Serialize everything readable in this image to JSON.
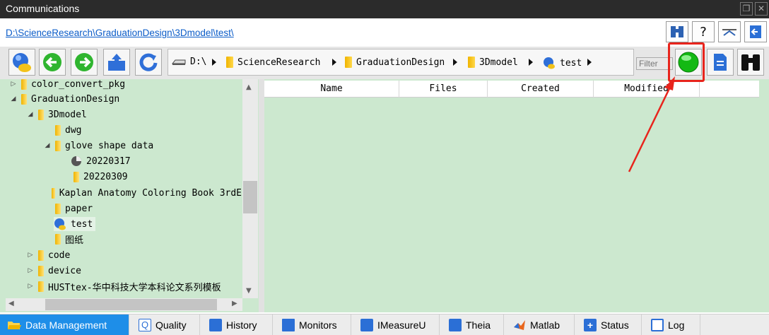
{
  "window": {
    "title": "Communications"
  },
  "path": {
    "text": "D:\\ScienceResearch\\GraduationDesign\\3Dmodel\\test\\"
  },
  "breadcrumb": {
    "drive": "D:\\",
    "items": [
      "ScienceResearch",
      "GraduationDesign",
      "3Dmodel",
      "test"
    ]
  },
  "toolbar": {
    "filter_placeholder": "Filter",
    "help_label": "?"
  },
  "tree": {
    "items": [
      {
        "label": "color_convert_pkg"
      },
      {
        "label": "GraduationDesign"
      },
      {
        "label": "3Dmodel"
      },
      {
        "label": "dwg"
      },
      {
        "label": "glove shape data"
      },
      {
        "label": "20220317"
      },
      {
        "label": "20220309"
      },
      {
        "label": "Kaplan Anatomy Coloring Book 3rdE"
      },
      {
        "label": "paper"
      },
      {
        "label": "test"
      },
      {
        "label": "图纸"
      },
      {
        "label": "code"
      },
      {
        "label": "device"
      },
      {
        "label": "HUSTtex-华中科技大学本科论文系列模板"
      }
    ]
  },
  "grid": {
    "columns": [
      "Name",
      "Files",
      "Created",
      "Modified"
    ]
  },
  "tabs": [
    {
      "label": "Data Management"
    },
    {
      "label": "Quality"
    },
    {
      "label": "History"
    },
    {
      "label": "Monitors"
    },
    {
      "label": "IMeasureU"
    },
    {
      "label": "Theia"
    },
    {
      "label": "Matlab"
    },
    {
      "label": "Status"
    },
    {
      "label": "Log"
    }
  ],
  "colors": {
    "panel_green": "#cce8cf",
    "active_tab": "#1e8ee8",
    "annotation": "#e8241c",
    "titlebar": "#2b2b2b"
  }
}
